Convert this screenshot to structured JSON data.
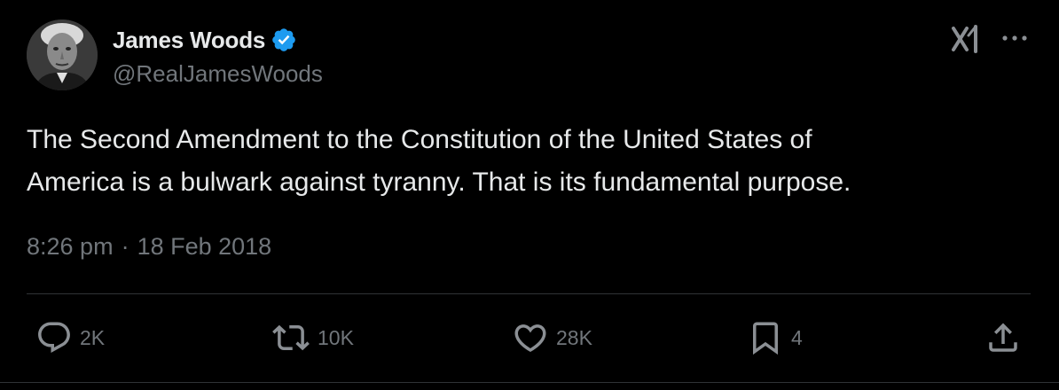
{
  "author": {
    "display_name": "James Woods",
    "handle": "@RealJamesWoods",
    "verified": true,
    "verified_color": "#1d9bf0",
    "avatar_icon": "profile-photo"
  },
  "header_actions": {
    "grok_icon": "grok-icon",
    "more_icon": "more-icon"
  },
  "tweet": {
    "text": "The Second Amendment to the Constitution of the United States of\nAmerica is a bulwark against tyranny. That is its fundamental purpose.",
    "time": "8:26 pm",
    "separator": "·",
    "date": "18 Feb 2018"
  },
  "actions": {
    "reply": {
      "icon": "reply-icon",
      "count": "2K"
    },
    "repost": {
      "icon": "repost-icon",
      "count": "10K"
    },
    "like": {
      "icon": "heart-icon",
      "count": "28K"
    },
    "bookmark": {
      "icon": "bookmark-icon",
      "count": "4"
    },
    "share": {
      "icon": "share-icon"
    }
  },
  "colors": {
    "background": "#000000",
    "text_primary": "#e7e9ea",
    "text_secondary": "#71767b",
    "divider": "#2f3336"
  }
}
